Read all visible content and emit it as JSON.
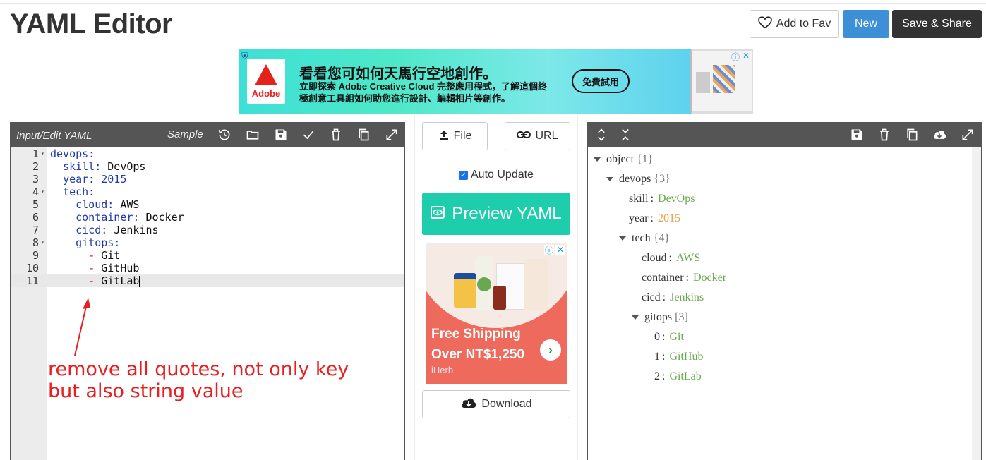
{
  "header": {
    "title": "YAML Editor",
    "fav_label": "Add to Fav",
    "new_label": "New",
    "save_label": "Save & Share"
  },
  "ad_top": {
    "brand": "Adobe",
    "headline": "看看您可如何天馬行空地創作。",
    "body": "立即探索 Adobe Creative Cloud 完整應用程式，了解這個終極創意工具組如何助您進行設計、編輯相片等創作。",
    "cta": "免費試用"
  },
  "editor": {
    "panel_title": "Input/Edit YAML",
    "sample_label": "Sample",
    "lines": [
      {
        "num": "1",
        "fold": true,
        "indent": "",
        "key": "devops",
        "sep": ":",
        "val": "",
        "dash": false
      },
      {
        "num": "2",
        "fold": false,
        "indent": "  ",
        "key": "skill",
        "sep": ": ",
        "val": "DevOps",
        "dash": false
      },
      {
        "num": "3",
        "fold": false,
        "indent": "  ",
        "key": "year",
        "sep": ": ",
        "val": "2015",
        "dash": false,
        "numeric": true
      },
      {
        "num": "4",
        "fold": true,
        "indent": "  ",
        "key": "tech",
        "sep": ":",
        "val": "",
        "dash": false
      },
      {
        "num": "5",
        "fold": false,
        "indent": "    ",
        "key": "cloud",
        "sep": ": ",
        "val": "AWS",
        "dash": false
      },
      {
        "num": "6",
        "fold": false,
        "indent": "    ",
        "key": "container",
        "sep": ": ",
        "val": "Docker",
        "dash": false
      },
      {
        "num": "7",
        "fold": false,
        "indent": "    ",
        "key": "cicd",
        "sep": ": ",
        "val": "Jenkins",
        "dash": false
      },
      {
        "num": "8",
        "fold": true,
        "indent": "    ",
        "key": "gitops",
        "sep": ":",
        "val": "",
        "dash": false
      },
      {
        "num": "9",
        "fold": false,
        "indent": "      ",
        "key": "",
        "sep": "",
        "val": "Git",
        "dash": true
      },
      {
        "num": "10",
        "fold": false,
        "indent": "      ",
        "key": "",
        "sep": "",
        "val": "GitHub",
        "dash": true
      },
      {
        "num": "11",
        "fold": false,
        "indent": "      ",
        "key": "",
        "sep": "",
        "val": "GitLab",
        "dash": true,
        "active": true
      }
    ]
  },
  "annotation": {
    "line1": "remove all quotes, not only key",
    "line2": "but also string value"
  },
  "middle": {
    "file_label": "File",
    "url_label": "URL",
    "auto_update_label": "Auto Update",
    "auto_update_checked": true,
    "preview_label": "Preview YAML",
    "download_label": "Download"
  },
  "ad_side": {
    "line1": "Free Shipping",
    "line2": "Over NT$1,250",
    "brand": "iHerb"
  },
  "tree": {
    "nodes": [
      {
        "label": "object",
        "count": "{1}",
        "expand": true
      },
      {
        "label": "devops",
        "count": "{3}",
        "expand": true
      },
      {
        "label": "skill",
        "value": "DevOps",
        "type": "string"
      },
      {
        "label": "year",
        "value": "2015",
        "type": "number"
      },
      {
        "label": "tech",
        "count": "{4}",
        "expand": true
      },
      {
        "label": "cloud",
        "value": "AWS",
        "type": "string"
      },
      {
        "label": "container",
        "value": "Docker",
        "type": "string"
      },
      {
        "label": "cicd",
        "value": "Jenkins",
        "type": "string"
      },
      {
        "label": "gitops",
        "count": "[3]",
        "expand": true
      },
      {
        "label": "0",
        "value": "Git",
        "type": "string"
      },
      {
        "label": "1",
        "value": "GitHub",
        "type": "string"
      },
      {
        "label": "2",
        "value": "GitLab",
        "type": "string"
      }
    ]
  },
  "colors": {
    "new_button": "#3d8fd6",
    "preview_button": "#1ecdab",
    "panel_header": "#555555",
    "annotation": "#e62020",
    "tree_string": "#6aa84f",
    "tree_number": "#e6a042"
  }
}
